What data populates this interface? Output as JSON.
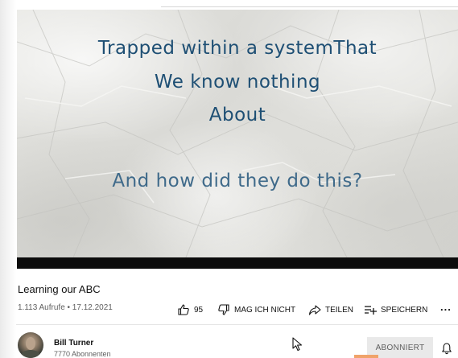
{
  "video": {
    "lines": [
      "Trapped within a systemThat",
      "We know nothing",
      "About",
      "And how did they do this?"
    ]
  },
  "details": {
    "title": "Learning our ABC",
    "meta": "1.113 Aufrufe • 17.12.2021"
  },
  "actions": {
    "like_count": "95",
    "dislike_label": "MAG ICH NICHT",
    "share_label": "TEILEN",
    "save_label": "SPEICHERN",
    "more_label": "..."
  },
  "channel": {
    "name": "Bill Turner",
    "subscribers": "7770 Abonnenten",
    "subscribe_label": "ABONNIERT"
  },
  "icons": {
    "like": "thumbs-up-icon",
    "dislike": "thumbs-down-icon",
    "share": "share-arrow-icon",
    "save": "add-to-playlist-icon",
    "bell": "bell-icon",
    "cursor": "mouse-pointer-icon"
  },
  "colors": {
    "video_text": "#1e4f74",
    "video_text_secondary": "#3f6a8a",
    "subscribe_bg": "#e9e9e9"
  }
}
